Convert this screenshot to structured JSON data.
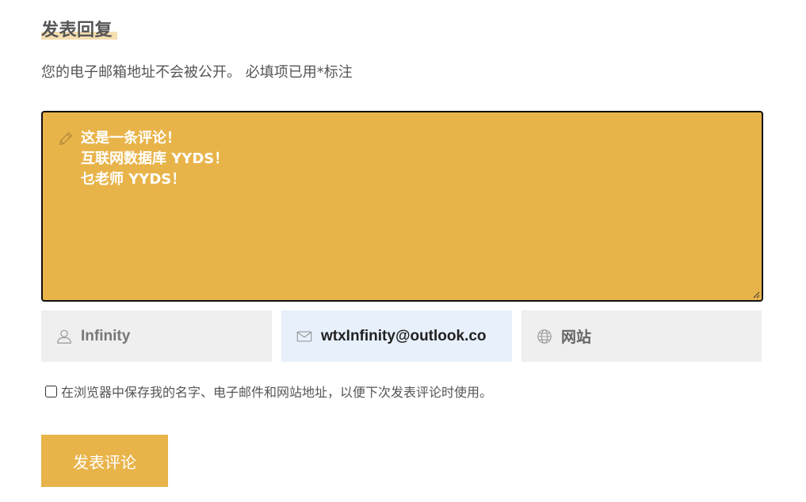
{
  "reply": {
    "title": "发表回复",
    "notice": "您的电子邮箱地址不会被公开。 必填项已用*标注"
  },
  "comment": {
    "lines": [
      "这是一条评论！",
      "互联网数据库 YYDS！",
      "乜老师 YYDS！"
    ],
    "icon": "pencil-icon"
  },
  "fields": {
    "name": {
      "value": "Infinity",
      "icon": "user-icon"
    },
    "email": {
      "value": "wtxInfinity@outlook.co",
      "icon": "envelope-icon"
    },
    "website": {
      "placeholder": "网站",
      "icon": "globe-icon"
    }
  },
  "save_info": {
    "label": "在浏览器中保存我的名字、电子邮件和网站地址，以便下次发表评论时使用。",
    "checked": false
  },
  "submit": {
    "label": "发表评论"
  },
  "colors": {
    "accent": "#e8b44a",
    "title_highlight": "#f5deb0",
    "field_bg": "#efefef",
    "email_field_bg": "#e8f0fc"
  }
}
